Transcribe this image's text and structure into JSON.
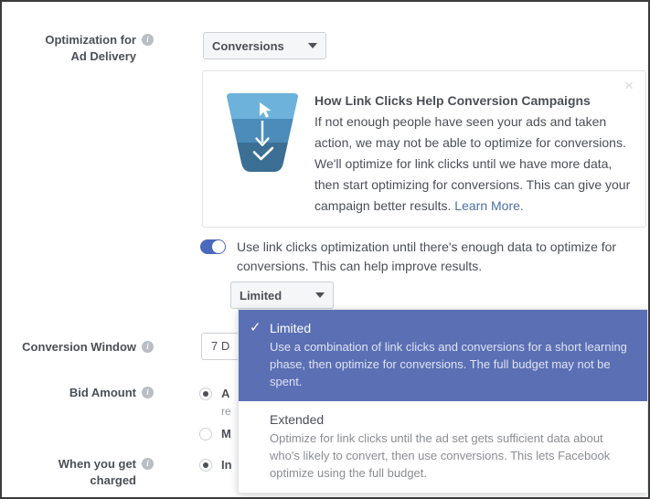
{
  "form": {
    "rows": [
      {
        "label_line1": "Optimization for",
        "label_line2": "Ad Delivery",
        "info_icon": "info-icon",
        "value": "Conversions"
      },
      {
        "label_line1": "Conversion Window",
        "label_line2": "",
        "info_icon": "info-icon",
        "value": "7 D"
      },
      {
        "label_line1": "Bid Amount",
        "label_line2": "",
        "info_icon": "info-icon",
        "value": ""
      },
      {
        "label_line1": "When you get",
        "label_line2": "charged",
        "info_icon": "info-icon",
        "value": ""
      }
    ]
  },
  "info_card": {
    "close_icon": "close-icon",
    "funnel_icon": "funnel-icon",
    "title": "How Link Clicks Help Conversion Campaigns",
    "body": "If not enough people have seen your ads and taken action, we may not be able to optimize for conversions. We'll optimize for link clicks until we have more data, then start optimizing for conversions. This can give your campaign better results. ",
    "link": "Learn More.",
    "link_color": "#4b6ea9",
    "funnel_colors": {
      "top": "#6cb2db",
      "middle": "#4b8cba",
      "bottom": "#3b6f93"
    }
  },
  "toggle": {
    "state": "on",
    "accent_color": "#4c68bc",
    "label": "Use link clicks optimization until there's enough data to optimize for conversions. This can help improve results."
  },
  "limited_select": {
    "value": "Limited",
    "caret_icon": "chevron-down-icon"
  },
  "bid_amount": {
    "options": [
      {
        "label": "A",
        "sub": "re",
        "checked": true
      },
      {
        "label": "M",
        "sub": "",
        "checked": false
      }
    ]
  },
  "when_charged": {
    "options": [
      {
        "label": "In",
        "sub": "",
        "checked": true
      }
    ]
  },
  "dropdown": {
    "highlight_color": "#5b6fb5",
    "items": [
      {
        "check_icon": "check-icon",
        "title": "Limited",
        "description": "Use a combination of link clicks and conversions for a short learning phase, then optimize for conversions. The full budget may not be spent.",
        "selected": true
      },
      {
        "check_icon": "",
        "title": "Extended",
        "description": "Optimize for link clicks until the ad set gets sufficient data about who's likely to convert, then use conversions. This lets Facebook optimize using the full budget.",
        "selected": false
      }
    ]
  }
}
